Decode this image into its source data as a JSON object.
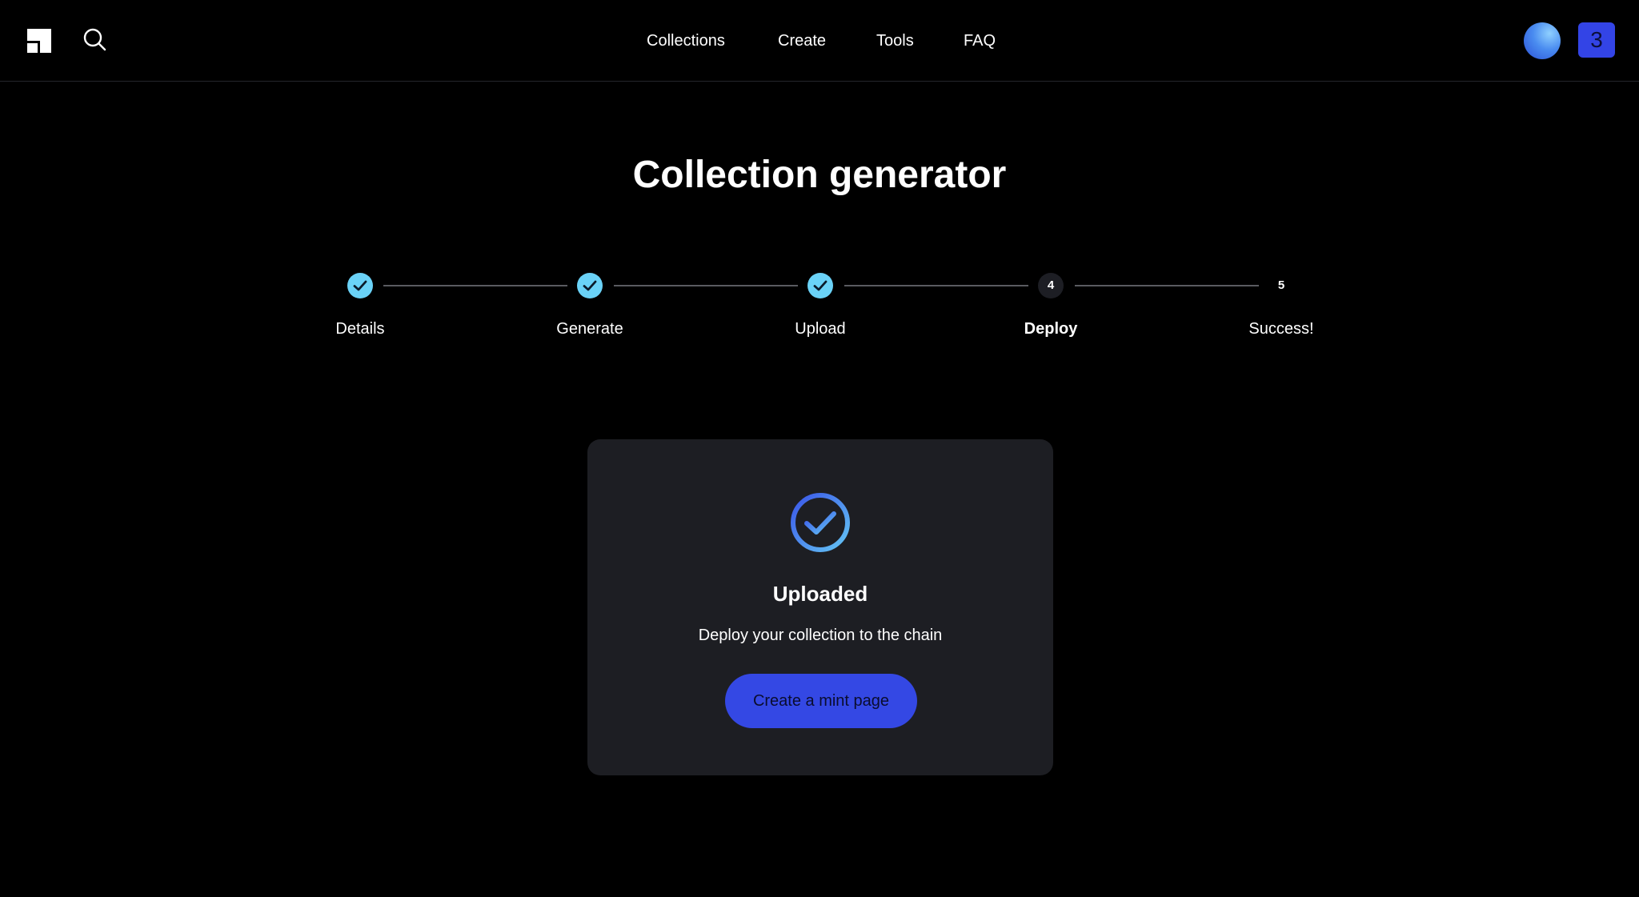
{
  "header": {
    "nav": [
      {
        "label": "Collections"
      },
      {
        "label": "Create"
      },
      {
        "label": "Tools"
      },
      {
        "label": "FAQ"
      }
    ],
    "badge_count": "3",
    "icons": {
      "logo": "logo-icon",
      "search": "search-icon"
    }
  },
  "main": {
    "title": "Collection generator",
    "stepper": {
      "current_step": 4,
      "steps": [
        {
          "number": "1",
          "label": "Details",
          "status": "complete"
        },
        {
          "number": "2",
          "label": "Generate",
          "status": "complete"
        },
        {
          "number": "3",
          "label": "Upload",
          "status": "complete"
        },
        {
          "number": "4",
          "label": "Deploy",
          "status": "current"
        },
        {
          "number": "5",
          "label": "Success!",
          "status": "pending"
        }
      ]
    },
    "card": {
      "title": "Uploaded",
      "subtitle": "Deploy your collection to the chain",
      "cta_label": "Create a mint page"
    }
  },
  "colors": {
    "background": "#000000",
    "card": "#1d1e23",
    "step_complete": "#6ad2f7",
    "accent": "#3448e4"
  }
}
